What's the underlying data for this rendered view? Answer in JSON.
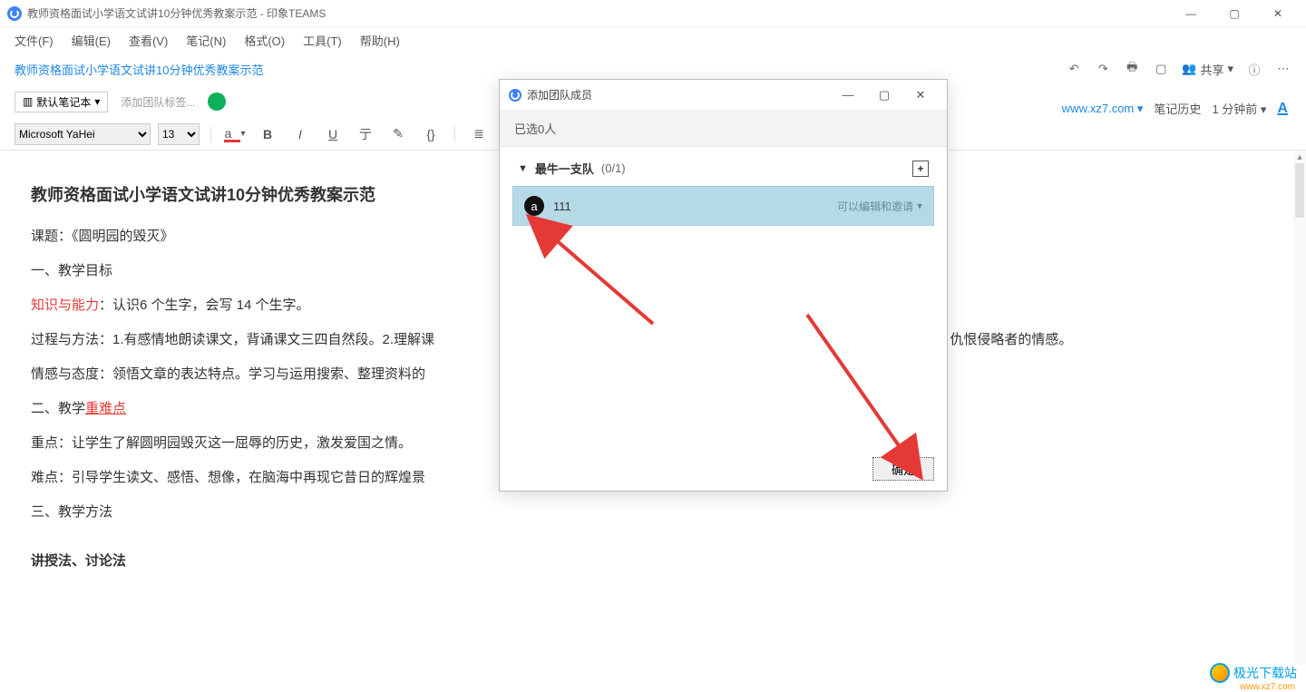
{
  "window": {
    "title": "教师资格面试小学语文试讲10分钟优秀教案示范 - 印象TEAMS"
  },
  "menu": {
    "file": "文件(F)",
    "edit": "编辑(E)",
    "view": "查看(V)",
    "note": "笔记(N)",
    "format": "格式(O)",
    "tools": "工具(T)",
    "help": "帮助(H)"
  },
  "breadcrumb": {
    "path": "教师资格面试小学语文试讲10分钟优秀教案示范"
  },
  "toolbar_right": {
    "share": "共享",
    "share_arrow": "▾"
  },
  "tagrow": {
    "notebook": "默认笔记本",
    "notebook_arrow": "▾",
    "add_tag": "添加团队标签..."
  },
  "right_info": {
    "site": "www.xz7.com",
    "site_arrow": "▾",
    "history": "笔记历史",
    "updated": "1 分钟前",
    "updated_arrow": "▾"
  },
  "fmt": {
    "font_name": "Microsoft YaHei",
    "font_size": "13",
    "color_letter": "a"
  },
  "doc": {
    "title": "教师资格面试小学语文试讲10分钟优秀教案示范",
    "topic": "课题：《圆明园的毁灭》",
    "h1": "一、教学目标",
    "p_zhi_label": "知识与能力",
    "p_zhi_rest": "：认识6 个生字，会写 14 个生字。",
    "p_guo": "过程与方法：1.有感情地朗读课文，背诵课文三四自然段。2.理解课",
    "p_guo_tail": "化、仇恨侵略者的情感。",
    "p_qing": "情感与态度：领悟文章的表达特点。学习与运用搜索、整理资料的",
    "h2_pre": "二、教学",
    "h2_red": "重难点",
    "p_zhong": "重点：让学生了解圆明园毁灭这一屈辱的历史，激发爱国之情。",
    "p_nan": "难点：引导学生读文、感悟、想像，在脑海中再现它昔日的辉煌景",
    "h3": "三、教学方法",
    "methods": "讲授法、讨论法"
  },
  "modal": {
    "title": "添加团队成员",
    "selected": "已选0人",
    "team_name": "最牛一支队",
    "team_count": "(0/1)",
    "member_name": "111",
    "member_letter": "a",
    "perm": "可以编辑和邀请",
    "perm_arrow": "▾",
    "ok": "确定"
  },
  "watermark": {
    "name": "极光下载站",
    "url": "www.xz7.com"
  }
}
